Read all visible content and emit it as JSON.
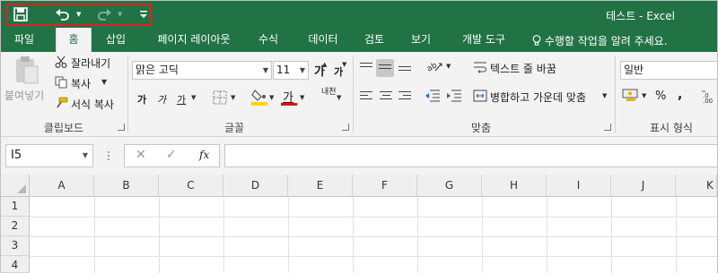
{
  "window": {
    "title": "테스트  -  Excel"
  },
  "qat": {
    "save_icon": "save-icon",
    "undo_icon": "undo-icon",
    "redo_icon": "redo-icon",
    "customize_icon": "customize-qat-icon"
  },
  "tabs": [
    {
      "label": "파일"
    },
    {
      "label": "홈"
    },
    {
      "label": "삽입"
    },
    {
      "label": "페이지 레이아웃"
    },
    {
      "label": "수식"
    },
    {
      "label": "데이터"
    },
    {
      "label": "검토"
    },
    {
      "label": "보기"
    },
    {
      "label": "개발 도구"
    }
  ],
  "tell_me": "수행할 작업을 알려 주세요.",
  "clipboard": {
    "paste": "붙여넣기",
    "cut": "잘라내기",
    "copy": "복사",
    "format_painter": "서식 복사",
    "group_label": "클립보드"
  },
  "font": {
    "name": "맑은 고딕",
    "size": "11",
    "grow": "가",
    "shrink": "가",
    "bold": "가",
    "italic": "가",
    "underline": "가",
    "font_color_glyph": "가",
    "phonetic": "내천",
    "group_label": "글꼴"
  },
  "alignment": {
    "wrap_text": "텍스트 줄 바꿈",
    "merge_center": "병합하고 가운데 맞춤",
    "group_label": "맞춤"
  },
  "number": {
    "format": "일반",
    "percent": "%",
    "comma": ",",
    "group_label": "표시 형식"
  },
  "formula_bar": {
    "name_box": "I5",
    "fx": "fx",
    "cancel": "✕",
    "enter": "✓"
  },
  "columns": [
    "A",
    "B",
    "C",
    "D",
    "E",
    "F",
    "G",
    "H",
    "I",
    "J",
    "K"
  ],
  "rows": [
    "1",
    "2",
    "3",
    "4"
  ],
  "colors": {
    "excel_green": "#217346",
    "highlight_callout": "#e02020",
    "fill_yellow": "#ffd400",
    "font_red": "#e01010"
  }
}
